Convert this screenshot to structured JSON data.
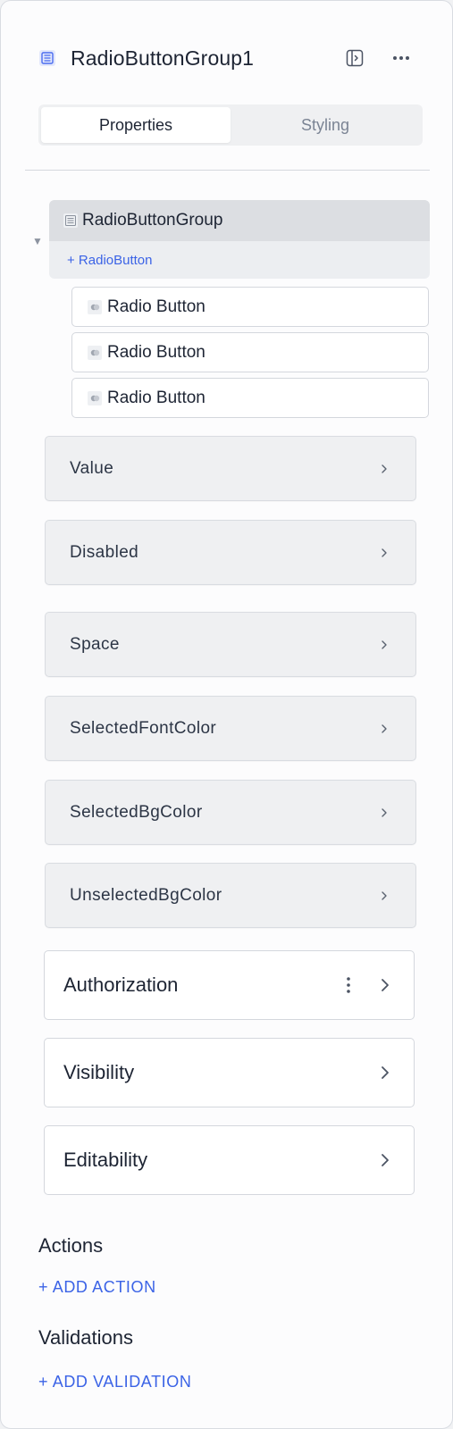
{
  "header": {
    "title": "RadioButtonGroup1",
    "component_icon": "list-component-icon",
    "panel_toggle_icon": "panel-toggle-icon",
    "more_icon": "more-horizontal-icon"
  },
  "tabs": [
    {
      "label": "Properties",
      "active": true
    },
    {
      "label": "Styling",
      "active": false
    }
  ],
  "tree": {
    "group_label": "RadioButtonGroup",
    "add_child_label": "+ RadioButton",
    "children": [
      {
        "label": "Radio Button"
      },
      {
        "label": "Radio Button"
      },
      {
        "label": "Radio Button"
      }
    ]
  },
  "properties": [
    {
      "label": "Value"
    },
    {
      "label": "Disabled"
    },
    {
      "label": "Space"
    },
    {
      "label": "SelectedFontColor"
    },
    {
      "label": "SelectedBgColor"
    },
    {
      "label": "UnselectedBgColor"
    }
  ],
  "sections": [
    {
      "label": "Authorization"
    },
    {
      "label": "Visibility"
    },
    {
      "label": "Editability"
    }
  ],
  "actions": {
    "title": "Actions",
    "add_label": "+ ADD ACTION"
  },
  "validations": {
    "title": "Validations",
    "add_label": "+ ADD VALIDATION"
  },
  "colors": {
    "accent": "#3b63e6",
    "text": "#1d2433",
    "muted": "#7b8494"
  }
}
